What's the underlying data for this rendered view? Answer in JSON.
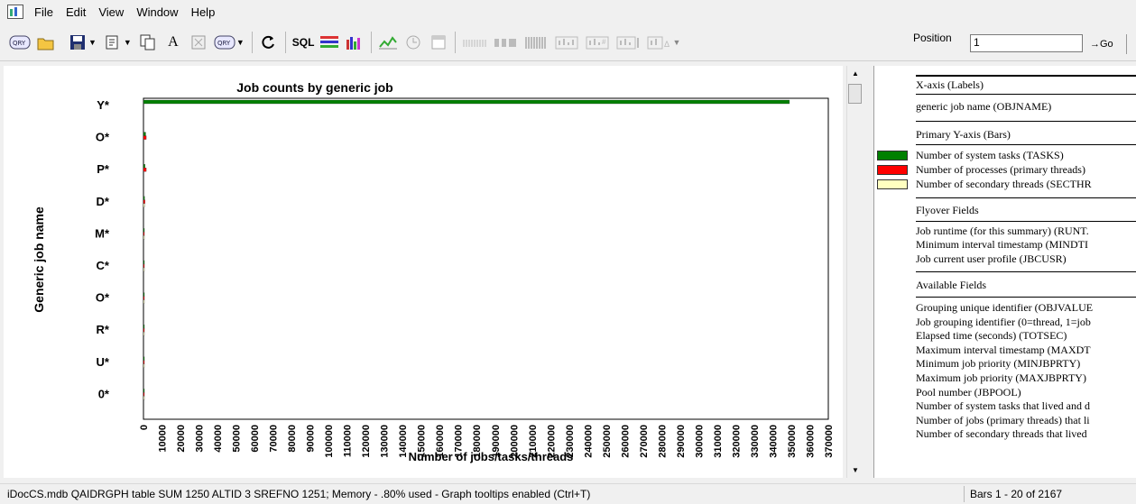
{
  "menu": [
    "File",
    "Edit",
    "View",
    "Window",
    "Help"
  ],
  "toolbar": {
    "sql_label": "SQL",
    "position_label": "Position",
    "position_value": "1",
    "go_label": "→Go"
  },
  "chart_data": {
    "type": "bar",
    "orientation": "horizontal",
    "title": "Job counts by generic job",
    "xlabel": "Number of jobs/tasks/threads",
    "ylabel": "Generic job name",
    "xlim": [
      0,
      370000
    ],
    "x_ticks": [
      "0",
      "10000",
      "20000",
      "30000",
      "40000",
      "50000",
      "60000",
      "70000",
      "80000",
      "90000",
      "100000",
      "110000",
      "120000",
      "130000",
      "140000",
      "150000",
      "160000",
      "170000",
      "180000",
      "190000",
      "200000",
      "210000",
      "220000",
      "230000",
      "240000",
      "250000",
      "260000",
      "270000",
      "280000",
      "290000",
      "300000",
      "310000",
      "320000",
      "330000",
      "340000",
      "350000",
      "360000",
      "370000"
    ],
    "categories": [
      "Y*",
      "O*",
      "P*",
      "D*",
      "M*",
      "C*",
      "O*",
      "R*",
      "U*",
      "0*"
    ],
    "series": [
      {
        "name": "Number of system tasks (TASKS)",
        "color": "#008000",
        "values": [
          349000,
          1200,
          800,
          600,
          300,
          200,
          150,
          100,
          80,
          50
        ]
      },
      {
        "name": "Number of processes (primary threads)",
        "color": "#ff0000",
        "values": [
          0,
          1500,
          1500,
          800,
          300,
          200,
          100,
          80,
          50,
          30
        ]
      },
      {
        "name": "Number of secondary threads (SECTHR",
        "color": "#ffffc0",
        "values": [
          0,
          0,
          0,
          600,
          200,
          100,
          50,
          30,
          20,
          10
        ]
      }
    ]
  },
  "legend": {
    "header_x": "X-axis (Labels)",
    "x_field": "generic job name (OBJNAME)",
    "header_y": "Primary Y-axis (Bars)",
    "y_fields": [
      {
        "label": "Number of system tasks (TASKS)",
        "color": "#008000"
      },
      {
        "label": "Number of processes (primary threads)",
        "color": "#ff0000"
      },
      {
        "label": "Number of secondary threads (SECTHR",
        "color": "#ffffc0"
      }
    ],
    "header_flyover": "Flyover Fields",
    "flyover_fields": [
      "Job runtime (for this summary) (RUNT.",
      "Minimum interval timestamp (MINDTI",
      "Job current user profile (JBCUSR)"
    ],
    "header_available": "Available Fields",
    "available_fields": [
      "Grouping unique identifier (OBJVALUE",
      "Job grouping identifier (0=thread, 1=job",
      "Elapsed time (seconds) (TOTSEC)",
      "Maximum interval timestamp (MAXDT",
      "Minimum job priority (MINJBPRTY)",
      "Maximum job priority (MAXJBPRTY)",
      "Pool number (JBPOOL)",
      "Number of system tasks that lived and d",
      "Number of jobs (primary threads) that li",
      "Number of secondary threads that lived"
    ]
  },
  "status": {
    "main": "iDocCS.mdb QAIDRGPH table SUM 1250 ALTID 3 SREFNO 1251; Memory - .80% used - Graph tooltips enabled (Ctrl+T)",
    "bars": "Bars 1 - 20 of 2167"
  }
}
